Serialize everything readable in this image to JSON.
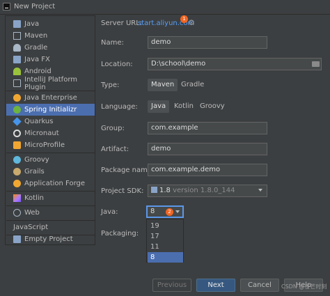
{
  "window": {
    "title": "New Project"
  },
  "sidebar": {
    "items": [
      {
        "label": "Java",
        "icon": "folder-icon",
        "color": "#8aa4c8"
      },
      {
        "label": "Maven",
        "icon": "maven-icon",
        "color": "#a9b7c6"
      },
      {
        "label": "Gradle",
        "icon": "gradle-icon",
        "color": "#a9b7c6"
      },
      {
        "label": "Java FX",
        "icon": "folder-icon",
        "color": "#8aa4c8"
      },
      {
        "label": "Android",
        "icon": "android-icon",
        "color": "#9ac23c"
      },
      {
        "label": "IntelliJ Platform Plugin",
        "icon": "plugin-icon",
        "color": "#a9b7c6"
      },
      {
        "label": "Java Enterprise",
        "icon": "enterprise-icon",
        "color": "#f0a732"
      },
      {
        "label": "Spring Initializr",
        "icon": "spring-icon",
        "color": "#6db33f"
      },
      {
        "label": "Quarkus",
        "icon": "quarkus-icon",
        "color": "#4695eb"
      },
      {
        "label": "Micronaut",
        "icon": "micronaut-icon",
        "color": "#dcdcdc"
      },
      {
        "label": "MicroProfile",
        "icon": "microprofile-icon",
        "color": "#f0a732"
      },
      {
        "label": "Groovy",
        "icon": "groovy-icon",
        "color": "#5fb7dc"
      },
      {
        "label": "Grails",
        "icon": "grails-icon",
        "color": "#c8a96e"
      },
      {
        "label": "Application Forge",
        "icon": "forge-icon",
        "color": "#f0a732"
      },
      {
        "label": "Kotlin",
        "icon": "kotlin-icon",
        "color": "#a97bff"
      },
      {
        "label": "Web",
        "icon": "globe-icon",
        "color": "#a9b7c6"
      },
      {
        "label": "JavaScript",
        "icon": "",
        "color": ""
      },
      {
        "label": "Empty Project",
        "icon": "folder-icon",
        "color": "#8aa4c8"
      }
    ],
    "selected_index": 7
  },
  "form": {
    "server_url_label": "Server URL:",
    "server_url": "start.aliyun.com",
    "badge1": "1",
    "name_label": "Name:",
    "name": "demo",
    "location_label": "Location:",
    "location": "D:\\school\\demo",
    "type_label": "Type:",
    "type_options": [
      "Maven",
      "Gradle"
    ],
    "language_label": "Language:",
    "language_options": [
      "Java",
      "Kotlin",
      "Groovy"
    ],
    "group_label": "Group:",
    "group": "com.example",
    "artifact_label": "Artifact:",
    "artifact": "demo",
    "package_label": "Package name:",
    "package": "com.example.demo",
    "sdk_label": "Project SDK:",
    "sdk_name": "1.8",
    "sdk_version": "version 1.8.0_144",
    "java_label": "Java:",
    "java_value": "8",
    "badge2": "2",
    "java_options": [
      "19",
      "17",
      "11",
      "8"
    ],
    "packaging_label": "Packaging:"
  },
  "buttons": {
    "previous": "Previous",
    "next": "Next",
    "cancel": "Cancel",
    "help": "Help"
  },
  "watermark": "CSDN @芒芒时刻"
}
